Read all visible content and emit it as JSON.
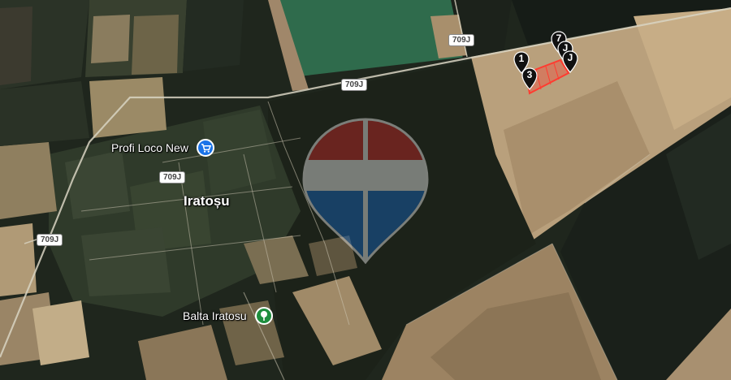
{
  "map": {
    "places": {
      "town": "Iratoșu",
      "poi_shop": "Profi Loco New",
      "poi_lake": "Balta Iratosu"
    },
    "road_label": "709J",
    "markers": [
      {
        "label": "1"
      },
      {
        "label": "3"
      },
      {
        "label": "7"
      },
      {
        "label": "J"
      },
      {
        "label": "J"
      }
    ],
    "colors": {
      "shop_icon": "#1a73e8",
      "park_icon": "#1e8e3e",
      "plot_outline": "#ff3b30",
      "watermark_top": "#c62828",
      "watermark_bottom": "#1565c0"
    }
  }
}
